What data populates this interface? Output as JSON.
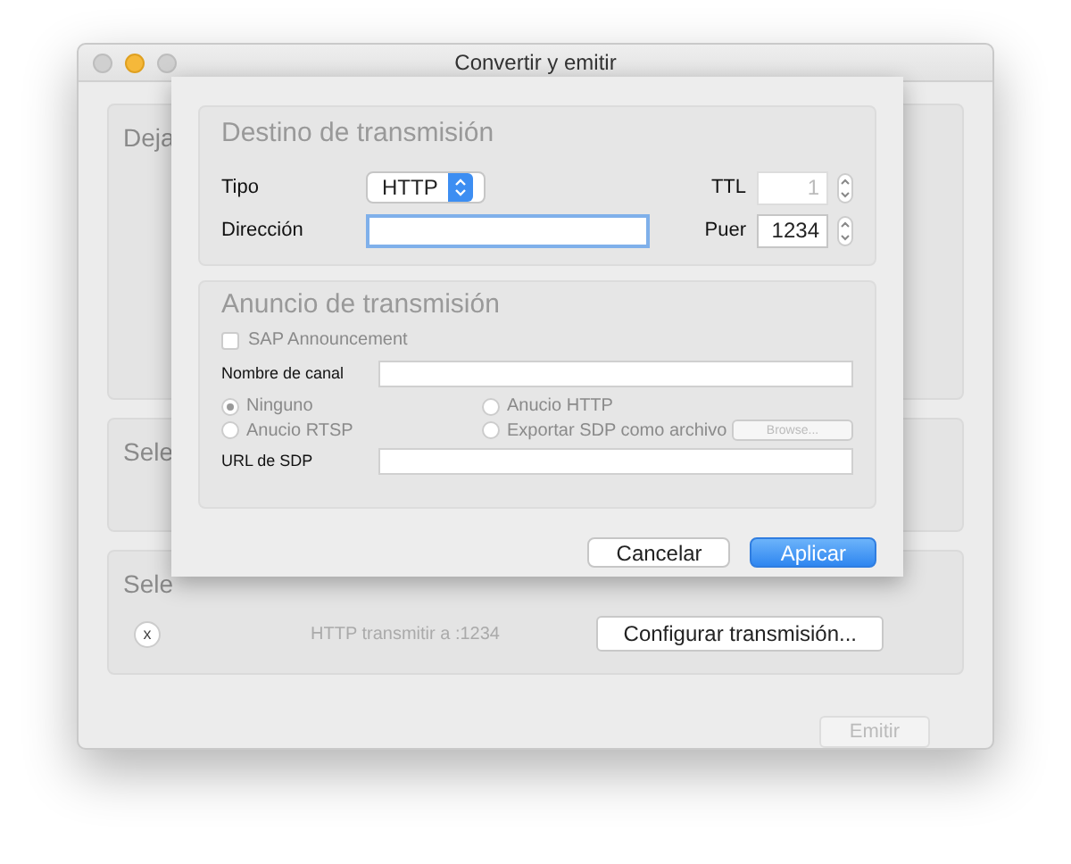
{
  "window": {
    "title": "Convertir y emitir"
  },
  "sections": [
    {
      "title": "Deja"
    },
    {
      "title": "Sele"
    },
    {
      "title": "Sele",
      "remove": "x",
      "summary": "HTTP transmitir a :1234",
      "button": "Configurar transmisión..."
    }
  ],
  "emit_button": {
    "label": "Emitir",
    "disabled": true
  },
  "dialog": {
    "destination": {
      "title": "Destino de transmisión",
      "type_label": "Tipo",
      "type_value": "HTTP",
      "ttl_label": "TTL",
      "ttl_value": "1",
      "ttl_disabled": true,
      "address_label": "Dirección",
      "address_focused": true,
      "port_label": "Puer",
      "port_value": "1234"
    },
    "announce": {
      "title": "Anuncio de transmisión",
      "sap": {
        "label": "SAP Announcement",
        "checked": false,
        "disabled": true
      },
      "channel_label": "Nombre de canal",
      "radios": [
        {
          "label": "Ninguno",
          "selected": true,
          "disabled": true
        },
        {
          "label": "Anucio HTTP",
          "selected": false,
          "disabled": true
        },
        {
          "label": "Anucio RTSP",
          "selected": false,
          "disabled": true
        },
        {
          "label": "Exportar SDP como archivo",
          "selected": false,
          "disabled": true
        }
      ],
      "browse": {
        "label": "Browse...",
        "disabled": true
      },
      "sdp_label": "URL de SDP"
    },
    "buttons": [
      {
        "label": "Cancelar",
        "kind": "default"
      },
      {
        "label": "Aplicar",
        "kind": "primary"
      }
    ]
  }
}
